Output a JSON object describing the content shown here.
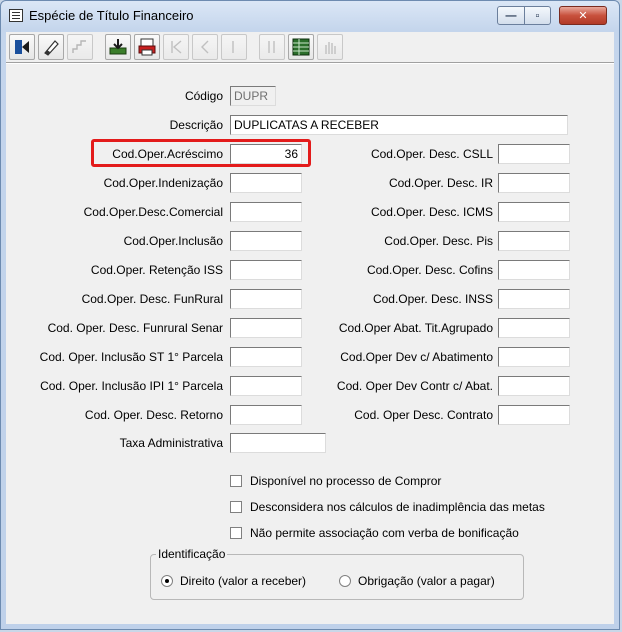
{
  "window": {
    "title": "Espécie de Título Financeiro",
    "min_glyph": "—",
    "max_glyph": "▫",
    "close_glyph": "✕"
  },
  "form": {
    "codigo": {
      "label": "Código",
      "value": "DUPR"
    },
    "descricao": {
      "label": "Descrição",
      "value": "DUPLICATAS A RECEBER"
    },
    "left": [
      {
        "label": "Cod.Oper.Acréscimo",
        "value": "36"
      },
      {
        "label": "Cod.Oper.Indenização",
        "value": ""
      },
      {
        "label": "Cod.Oper.Desc.Comercial",
        "value": ""
      },
      {
        "label": "Cod.Oper.Inclusão",
        "value": ""
      },
      {
        "label": "Cod.Oper. Retenção ISS",
        "value": ""
      },
      {
        "label": "Cod.Oper. Desc. FunRural",
        "value": ""
      },
      {
        "label": "Cod. Oper. Desc. Funrural Senar",
        "value": ""
      },
      {
        "label": "Cod. Oper. Inclusão ST 1° Parcela",
        "value": ""
      },
      {
        "label": "Cod. Oper. Inclusão IPI 1° Parcela",
        "value": ""
      },
      {
        "label": "Cod. Oper. Desc. Retorno",
        "value": ""
      }
    ],
    "right": [
      {
        "label": "Cod.Oper. Desc. CSLL",
        "value": ""
      },
      {
        "label": "Cod.Oper. Desc. IR",
        "value": ""
      },
      {
        "label": "Cod.Oper. Desc. ICMS",
        "value": ""
      },
      {
        "label": "Cod.Oper. Desc. Pis",
        "value": ""
      },
      {
        "label": "Cod.Oper. Desc. Cofins",
        "value": ""
      },
      {
        "label": "Cod.Oper. Desc. INSS",
        "value": ""
      },
      {
        "label": "Cod.Oper Abat. Tit.Agrupado",
        "value": ""
      },
      {
        "label": "Cod.Oper Dev c/ Abatimento",
        "value": ""
      },
      {
        "label": "Cod. Oper Dev Contr c/ Abat.",
        "value": ""
      },
      {
        "label": "Cod. Oper Desc. Contrato",
        "value": ""
      }
    ],
    "taxa": {
      "label": "Taxa Administrativa",
      "value": ""
    },
    "checks": [
      {
        "label": "Disponível no processo de Compror",
        "checked": false
      },
      {
        "label": "Desconsidera nos cálculos de inadimplência das metas",
        "checked": false
      },
      {
        "label": "Não permite associação com verba de bonificação",
        "checked": false
      }
    ],
    "identificacao": {
      "legend": "Identificação",
      "options": [
        {
          "label": "Direito (valor a receber)",
          "selected": true
        },
        {
          "label": "Obrigação (valor a pagar)",
          "selected": false
        }
      ]
    }
  },
  "toolbar": {
    "tools": [
      {
        "name": "exit-icon",
        "enabled": true
      },
      {
        "name": "eraser-icon",
        "enabled": true
      },
      {
        "name": "steps-icon",
        "enabled": false
      },
      {
        "name": "save-icon",
        "enabled": true
      },
      {
        "name": "print-icon",
        "enabled": true
      },
      {
        "name": "first-icon",
        "enabled": false
      },
      {
        "name": "prev-icon",
        "enabled": false
      },
      {
        "name": "next-icon",
        "enabled": false
      },
      {
        "name": "last-icon",
        "enabled": false
      },
      {
        "name": "grid-icon",
        "enabled": true
      },
      {
        "name": "hand-icon",
        "enabled": false
      }
    ]
  },
  "colors": {
    "highlight": "#e31b1b",
    "window_frame": "#c4d5ec",
    "panel": "#f0f0f0"
  }
}
